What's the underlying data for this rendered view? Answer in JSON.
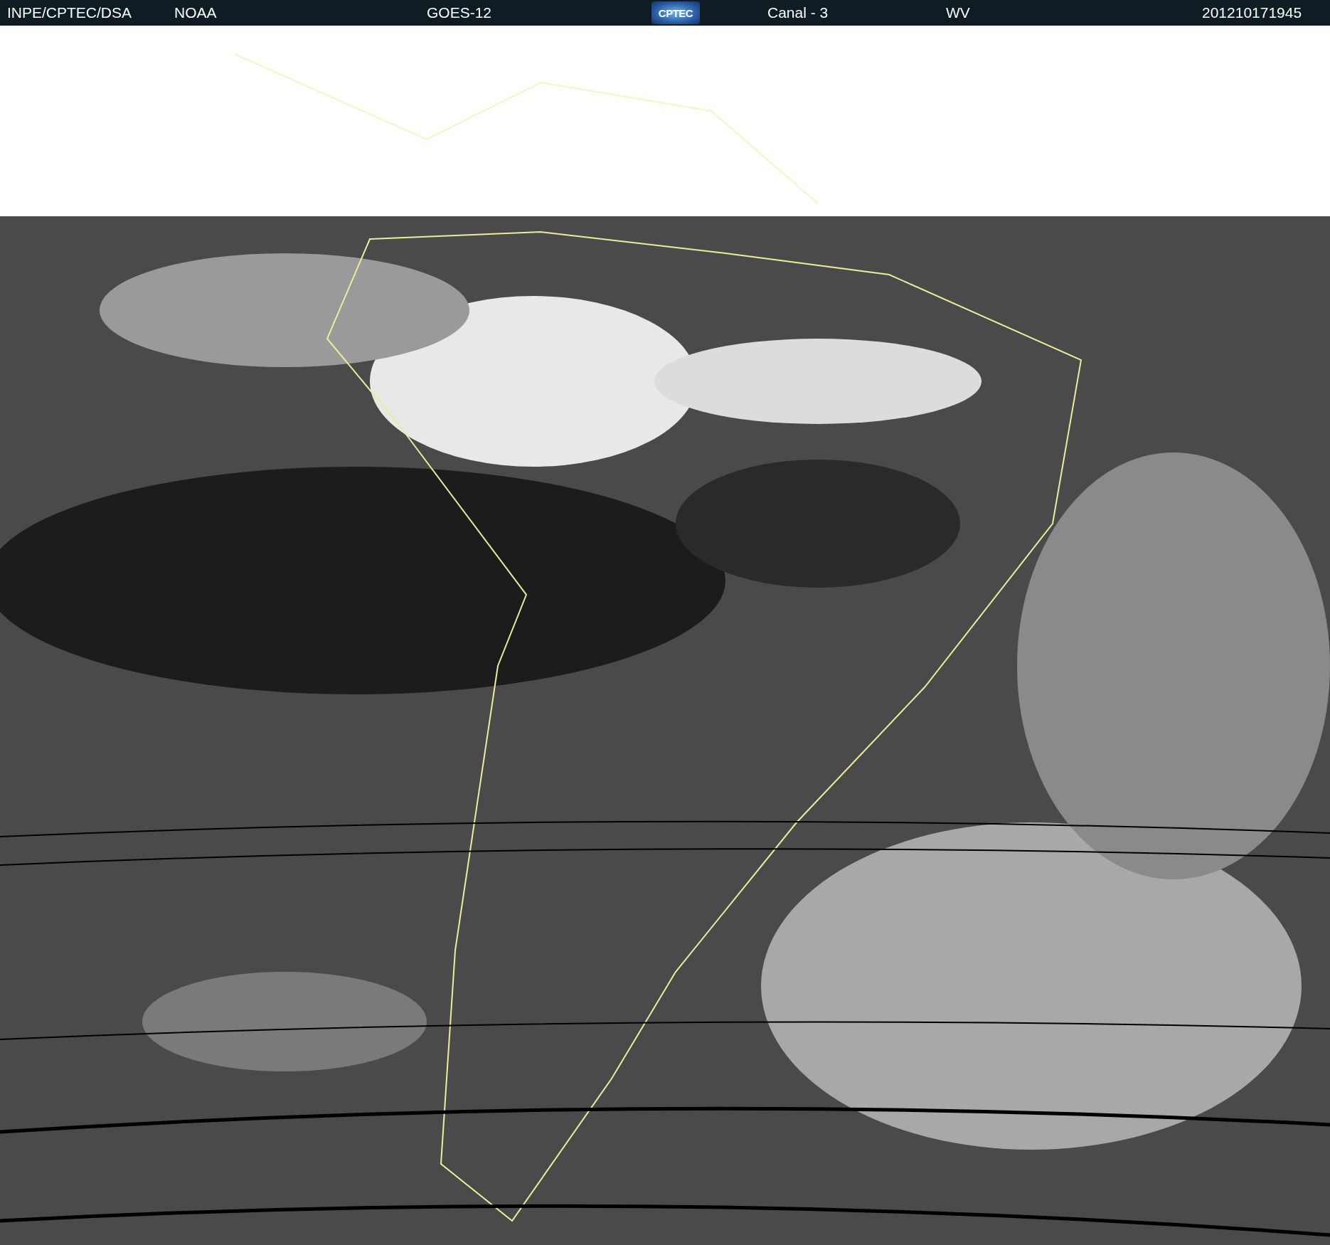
{
  "header": {
    "items": [
      {
        "kind": "text",
        "text": "INPE/CPTEC/DSA"
      },
      {
        "kind": "text",
        "text": "NOAA"
      },
      {
        "kind": "text",
        "text": "GOES-12"
      },
      {
        "kind": "logo",
        "text": "CPTEC"
      },
      {
        "kind": "text",
        "text": "Canal - 3"
      },
      {
        "kind": "text",
        "text": "WV"
      },
      {
        "kind": "text",
        "text": "201210171945"
      }
    ]
  }
}
